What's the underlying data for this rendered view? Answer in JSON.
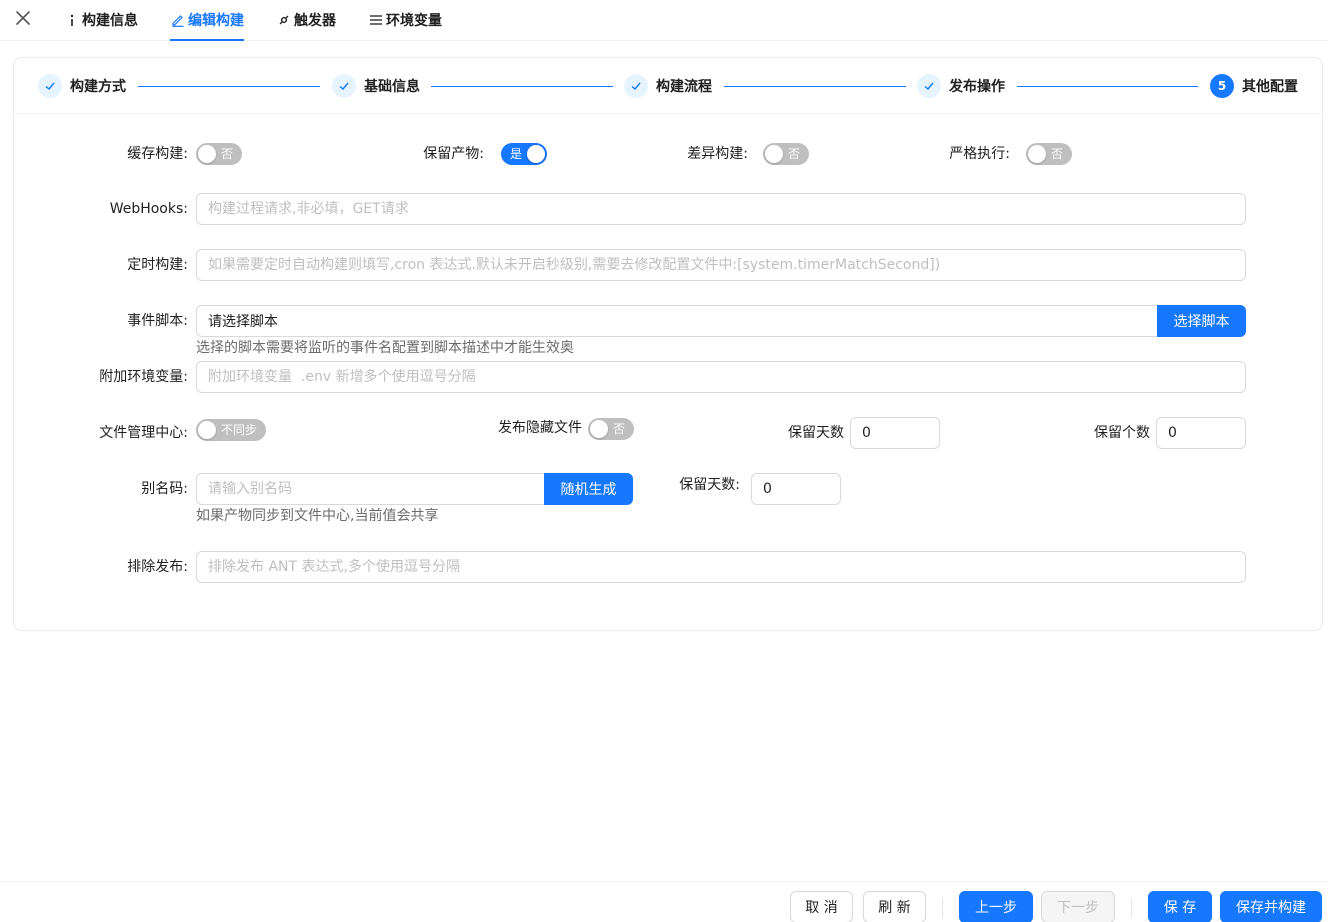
{
  "tabs": [
    {
      "label": "构建信息",
      "icon": "info-icon"
    },
    {
      "label": "编辑构建",
      "icon": "edit-icon"
    },
    {
      "label": "触发器",
      "icon": "api-icon"
    },
    {
      "label": "环境变量",
      "icon": "list-icon"
    }
  ],
  "accent_color": "#1677ff",
  "steps": [
    {
      "title": "构建方式",
      "status": "finished"
    },
    {
      "title": "基础信息",
      "status": "finished"
    },
    {
      "title": "构建流程",
      "status": "finished"
    },
    {
      "title": "发布操作",
      "status": "finished"
    },
    {
      "title": "其他配置",
      "status": "current",
      "number": "5"
    }
  ],
  "form": {
    "cache_build": {
      "label": "缓存构建:",
      "state": "否"
    },
    "keep_artifact": {
      "label": "保留产物:",
      "state": "是"
    },
    "diff_build": {
      "label": "差异构建:",
      "state": "否"
    },
    "strict_exec": {
      "label": "严格执行:",
      "state": "否"
    },
    "webhooks": {
      "label": "WebHooks:",
      "value": "",
      "placeholder": "构建过程请求,非必填，GET请求"
    },
    "timed_build": {
      "label": "定时构建:",
      "value": "",
      "placeholder": "如果需要定时自动构建则填写,cron 表达式.默认未开启秒级别,需要去修改配置文件中:[system.timerMatchSecond])"
    },
    "event_script": {
      "label": "事件脚本:",
      "value": "请选择脚本",
      "button": "选择脚本",
      "help": "选择的脚本需要将监听的事件名配置到脚本描述中才能生效奥"
    },
    "extra_env": {
      "label": "附加环境变量:",
      "value": "",
      "placeholder": "附加环境变量  .env 新增多个使用逗号分隔"
    },
    "file_center": {
      "label": "文件管理中心:",
      "state": "不同步"
    },
    "publish_hidden": {
      "label": "发布隐藏文件",
      "state": "否"
    },
    "keep_days": {
      "label": "保留天数",
      "value": "0"
    },
    "keep_count": {
      "label": "保留个数",
      "value": "0"
    },
    "alias_code": {
      "label": "别名码:",
      "value": "",
      "placeholder": "请输入别名码",
      "button": "随机生成",
      "help": "如果产物同步到文件中心,当前值会共享"
    },
    "alias_keep_days": {
      "label": "保留天数:",
      "value": "0"
    },
    "exclude_publish": {
      "label": "排除发布:",
      "value": "",
      "placeholder": "排除发布 ANT 表达式,多个使用逗号分隔"
    }
  },
  "footer": {
    "cancel": "取 消",
    "refresh": "刷 新",
    "prev": "上一步",
    "next": "下一步",
    "save": "保 存",
    "save_build": "保存并构建"
  }
}
